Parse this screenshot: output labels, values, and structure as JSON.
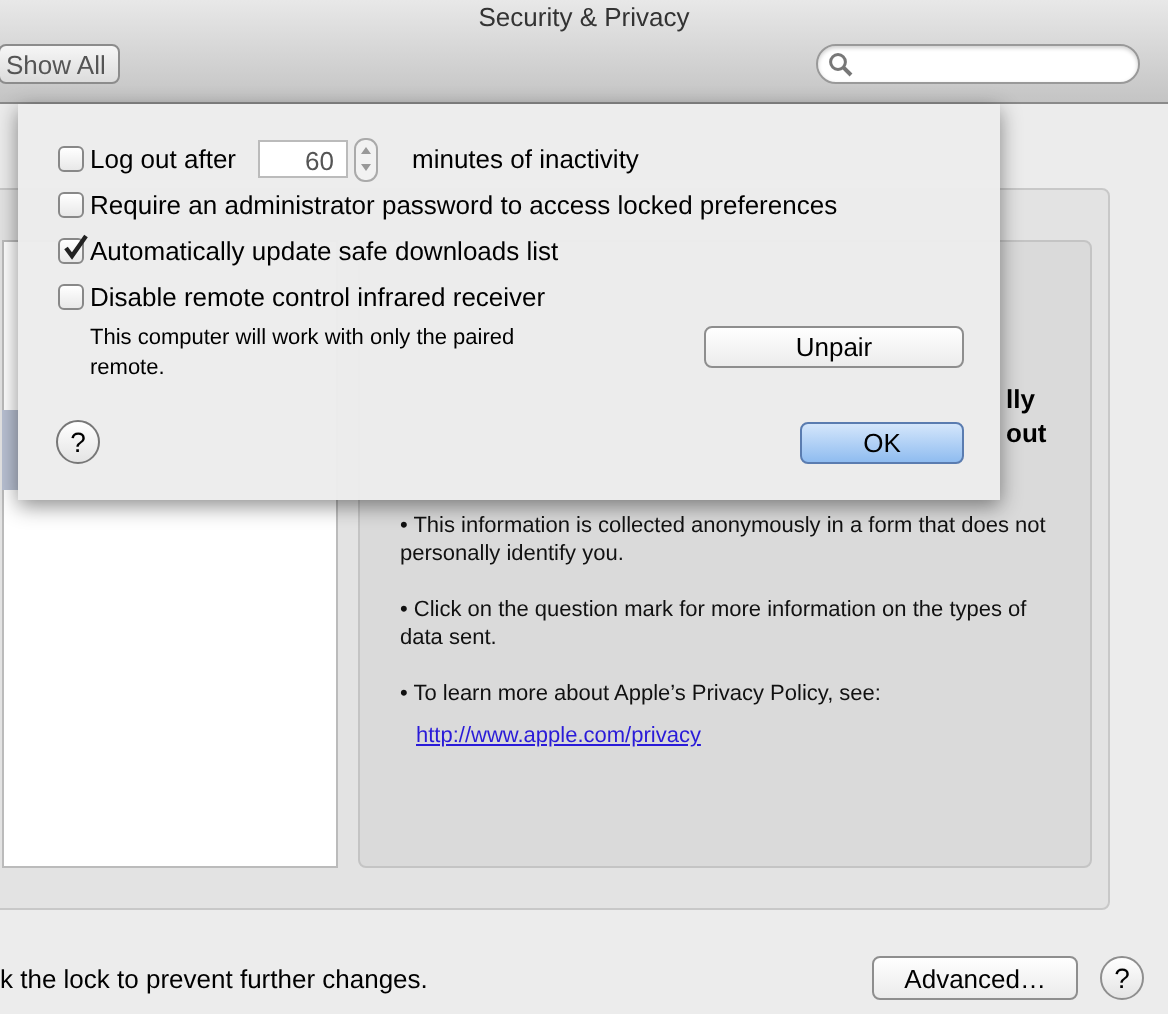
{
  "window": {
    "title": "Security & Privacy"
  },
  "toolbar": {
    "show_all": "Show All"
  },
  "panel": {
    "fragments": [
      "lly",
      "out"
    ],
    "bullets": [
      "• This information is collected anonymously in a form that does not personally identify you.",
      "• Click on the question mark for more information on the types of data sent.",
      "• To learn more about Apple’s Privacy Policy, see:"
    ],
    "link": "http://www.apple.com/privacy"
  },
  "sheet": {
    "options": [
      {
        "kind": "timeout",
        "label": "Log out after",
        "value": "60",
        "suffix": "minutes of inactivity",
        "checked": false
      },
      {
        "kind": "check",
        "label": "Require an administrator password to access locked preferences",
        "checked": false
      },
      {
        "kind": "check",
        "label": "Automatically update safe downloads list",
        "checked": true
      },
      {
        "kind": "check",
        "label": "Disable remote control infrared receiver",
        "checked": false
      }
    ],
    "note": "This computer will work with only the paired remote.",
    "unpair": "Unpair",
    "help": "?",
    "ok": "OK"
  },
  "footer": {
    "lock_text": "k the lock to prevent further changes.",
    "advanced": "Advanced…",
    "help": "?"
  }
}
